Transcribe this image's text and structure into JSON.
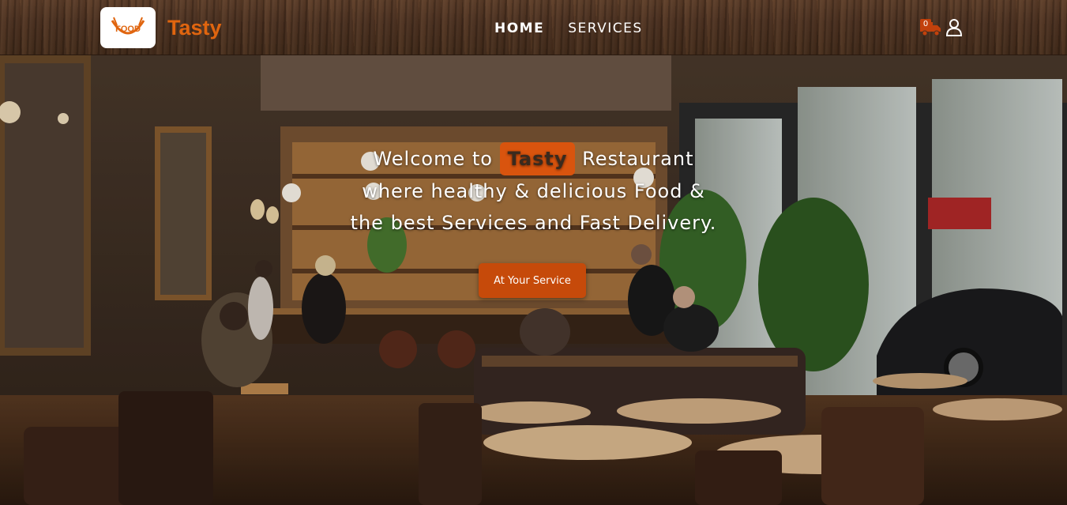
{
  "header": {
    "brand": "Tasty",
    "logo_text": "FOOD",
    "nav": [
      {
        "label": "HOME",
        "active": true
      },
      {
        "label": "SERVICES",
        "active": false
      }
    ],
    "cart_count": "0"
  },
  "hero": {
    "line1_prefix": "Welcome to ",
    "line1_highlight": "Tasty",
    "line1_suffix": " Restaurant",
    "line2": "where healthy & delicious Food &",
    "line3": "the best Services and Fast Delivery.",
    "cta_label": "At Your Service"
  },
  "colors": {
    "accent": "#e0650f",
    "button": "#c64a0a"
  },
  "icons": [
    "logo-icon",
    "delivery-truck-icon",
    "user-icon"
  ]
}
